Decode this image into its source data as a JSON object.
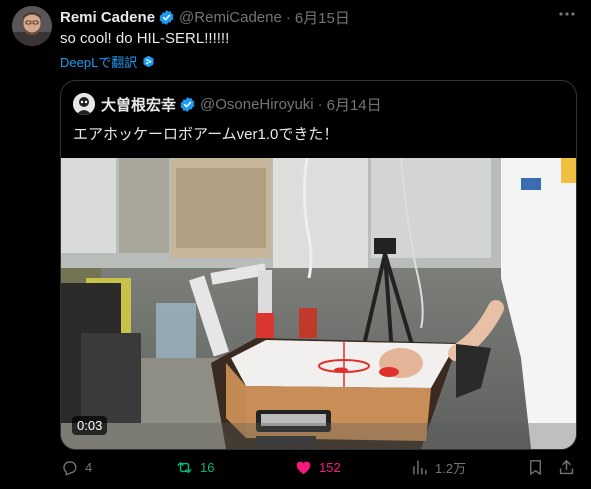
{
  "post": {
    "author_name": "Remi Cadene",
    "handle": "@RemiCadene",
    "separator": "·",
    "date": "6月15日",
    "more_label": "···",
    "text": "so cool! do HIL-SERL!!!!!!",
    "translate_label": "DeepLで翻訳"
  },
  "quoted_post": {
    "author_name": "大曽根宏幸",
    "handle": "@OsoneHiroyuki",
    "separator": "·",
    "date": "6月14日",
    "text": "エアホッケーロボアームver1.0できた！",
    "video_time": "0:03"
  },
  "actions": {
    "replies": "4",
    "reposts": "16",
    "likes": "152",
    "views": "1.2万"
  },
  "colors": {
    "accent": "#1d9bf0",
    "repost": "#00ba7c",
    "like": "#f91880",
    "muted": "#71767b"
  },
  "icons": [
    "verified-badge-icon",
    "more-icon",
    "deepl-icon",
    "reply-icon",
    "repost-icon",
    "heart-icon",
    "views-icon",
    "bookmark-icon",
    "share-icon"
  ]
}
